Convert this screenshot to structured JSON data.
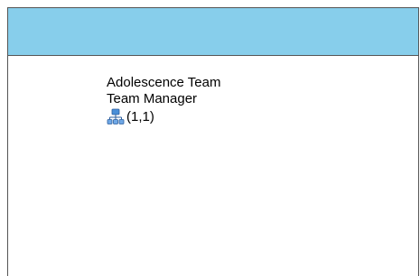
{
  "card": {
    "team_name": "Adolescence Team",
    "role": "Team Manager",
    "position": "(1,1)",
    "icon": "org-chart-icon"
  },
  "colors": {
    "header": "#87ceeb",
    "border": "#555555",
    "icon_box": "#4a8fd8"
  }
}
